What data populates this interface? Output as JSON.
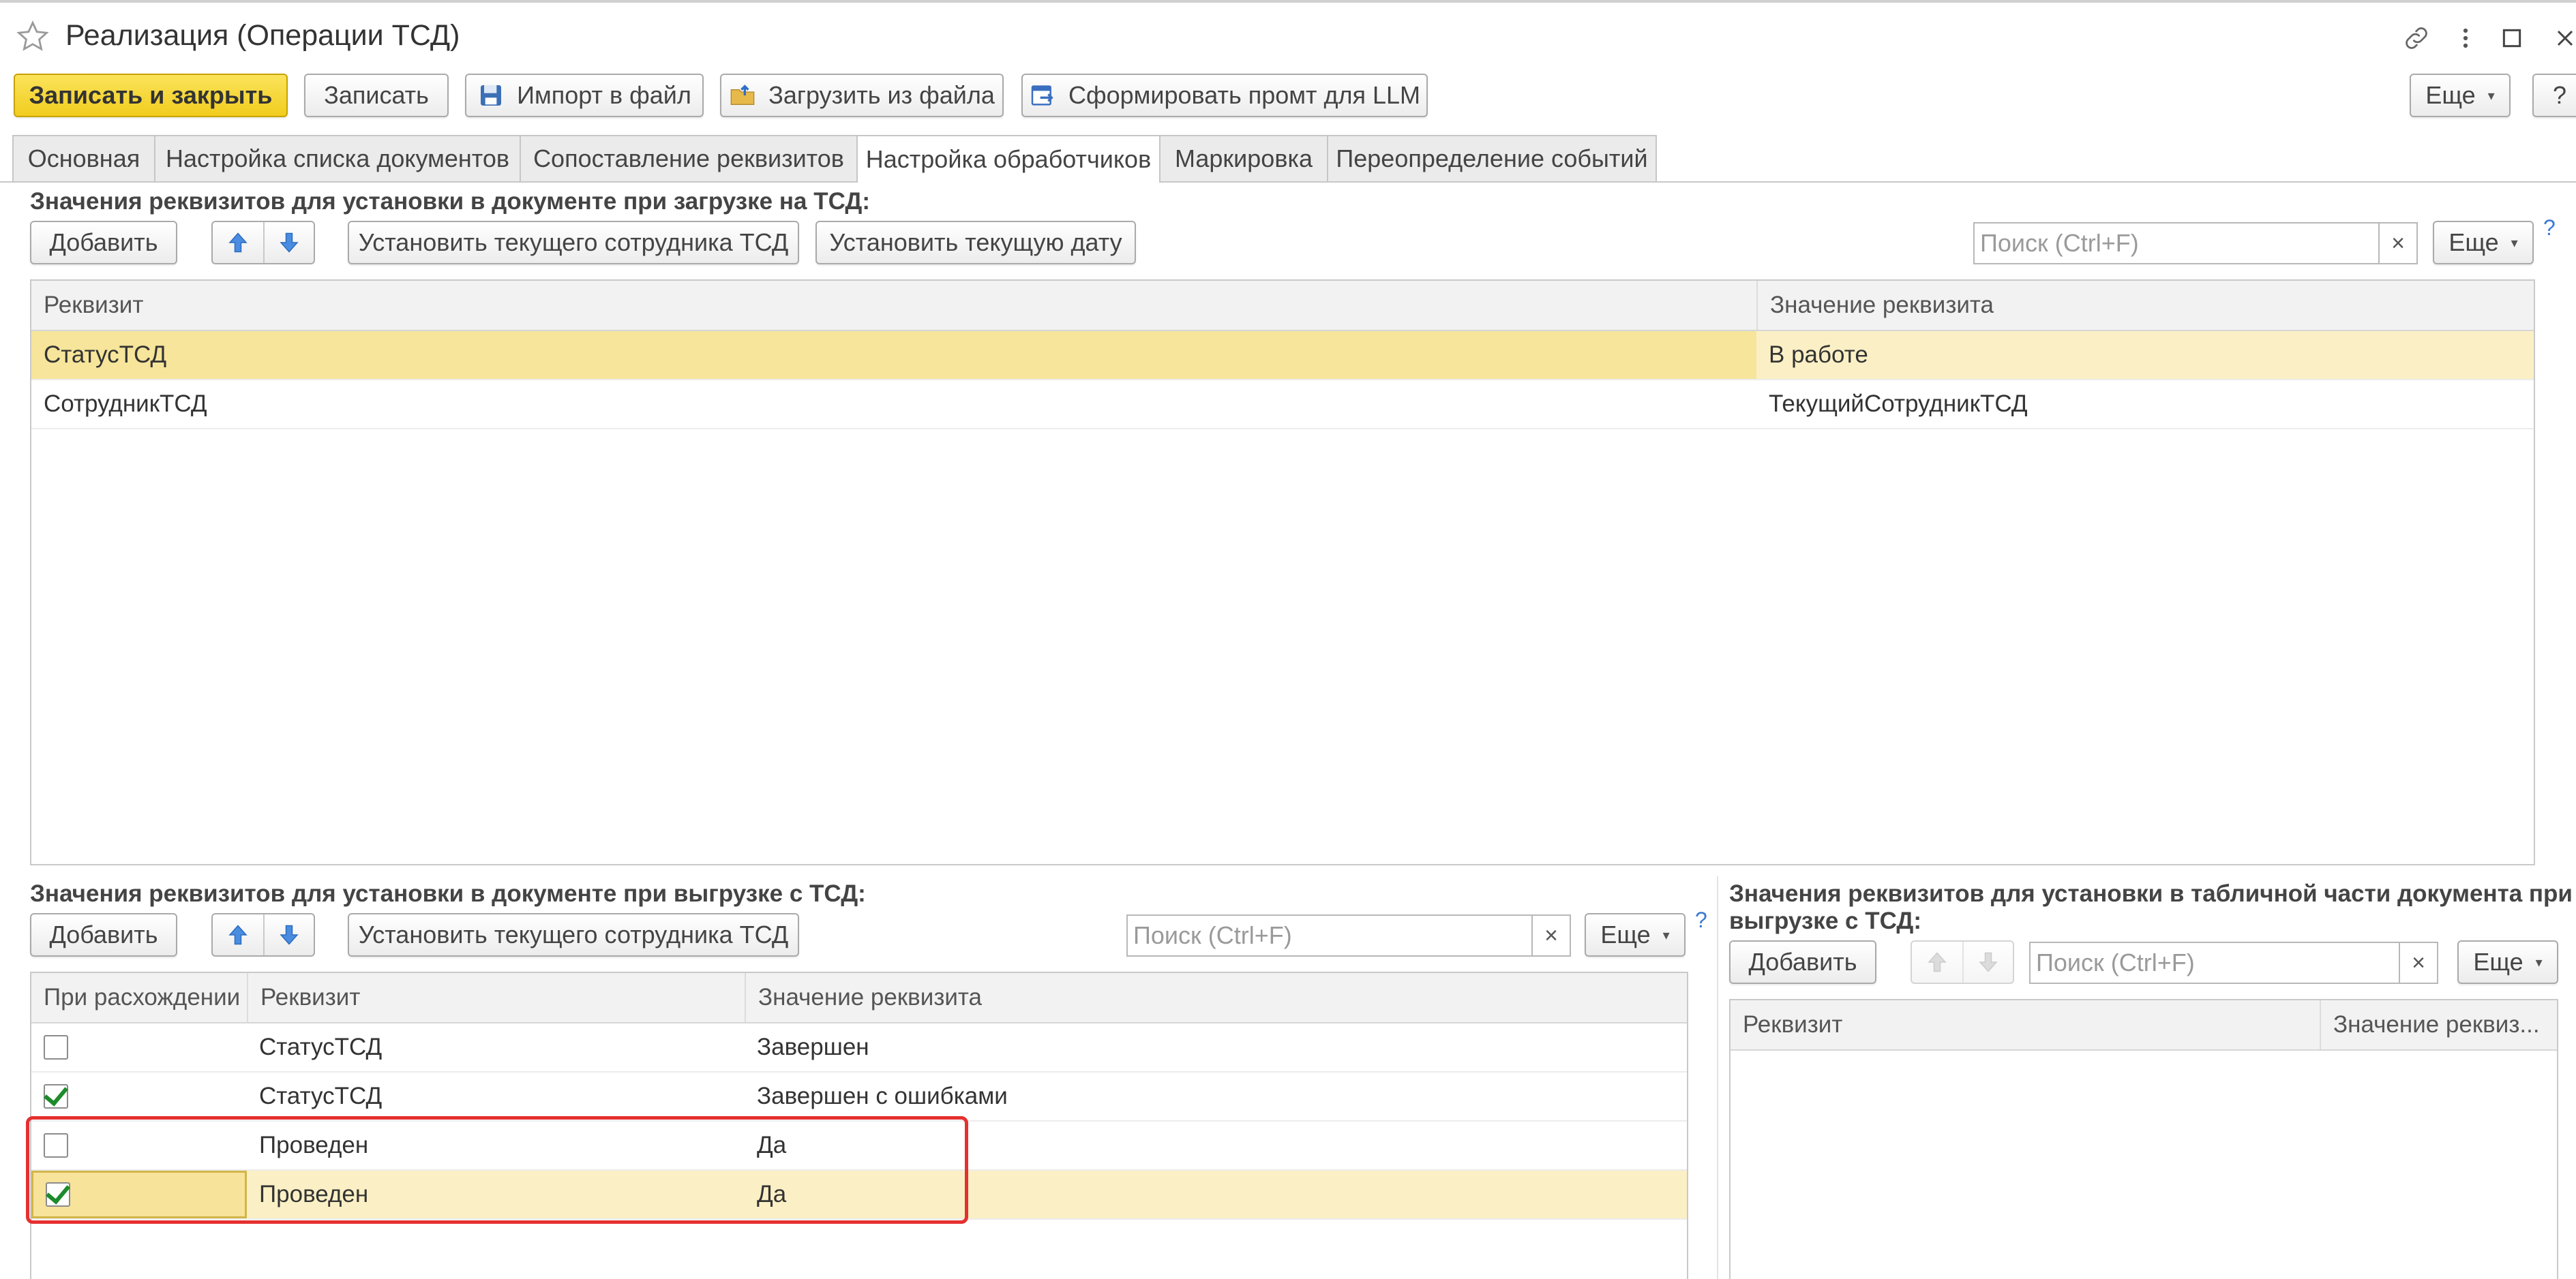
{
  "window": {
    "title": "Реализация (Операции ТСД)",
    "icons": [
      "link-icon",
      "more-vertical-icon",
      "maximize-icon",
      "close-icon"
    ]
  },
  "toolbar": {
    "save_close": "Записать и закрыть",
    "save": "Записать",
    "import": "Импорт в файл",
    "load": "Загрузить из файла",
    "prompt": "Сформировать промт для LLM",
    "more": "Еще",
    "help": "?"
  },
  "tabs": [
    {
      "label": "Основная"
    },
    {
      "label": "Настройка списка документов"
    },
    {
      "label": "Сопоставление реквизитов"
    },
    {
      "label": "Настройка обработчиков",
      "active": true
    },
    {
      "label": "Маркировка"
    },
    {
      "label": "Переопределение событий"
    }
  ],
  "section_upload": {
    "title": "Значения реквизитов для установки в документе при загрузке на ТСД:",
    "add": "Добавить",
    "set_employee": "Установить текущего сотрудника ТСД",
    "set_date": "Установить текущую дату",
    "search_placeholder": "Поиск (Ctrl+F)",
    "clear": "×",
    "more": "Еще",
    "help": "?",
    "columns": [
      "Реквизит",
      "Значение реквизита"
    ],
    "rows": [
      {
        "attr": "СтатусТСД",
        "value": "В работе",
        "selected": true
      },
      {
        "attr": "СотрудникТСД",
        "value": "ТекущийСотрудникТСД"
      }
    ]
  },
  "section_download": {
    "title": "Значения реквизитов для установки в документе при выгрузке с ТСД:",
    "add": "Добавить",
    "set_employee": "Установить текущего сотрудника ТСД",
    "search_placeholder": "Поиск (Ctrl+F)",
    "clear": "×",
    "more": "Еще",
    "help": "?",
    "columns": [
      "При расхождении",
      "Реквизит",
      "Значение реквизита"
    ],
    "rows": [
      {
        "checked": false,
        "attr": "СтатусТСД",
        "value": "Завершен"
      },
      {
        "checked": true,
        "attr": "СтатусТСД",
        "value": "Завершен с ошибками"
      },
      {
        "checked": false,
        "attr": "Проведен",
        "value": "Да"
      },
      {
        "checked": true,
        "attr": "Проведен",
        "value": "Да",
        "selected": true
      }
    ]
  },
  "section_table": {
    "title_line1": "Значения реквизитов для установки в табличной части документа при",
    "title_line2": "выгрузке с ТСД:",
    "add": "Добавить",
    "search_placeholder": "Поиск (Ctrl+F)",
    "clear": "×",
    "more": "Еще",
    "columns": [
      "Реквизит",
      "Значение реквиз..."
    ]
  },
  "colors": {
    "primary_button": "#f1cd1f",
    "selected_row": "#fbf0c5",
    "highlight_border": "#e53030",
    "check": "#1d8a2b",
    "help": "#3a7ad0"
  }
}
